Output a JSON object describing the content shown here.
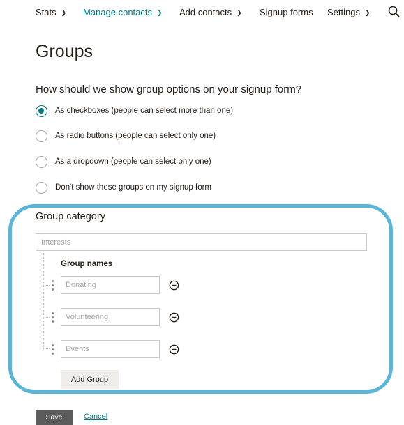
{
  "nav": {
    "items": [
      {
        "label": "Stats",
        "dropdown": true
      },
      {
        "label": "Manage contacts",
        "dropdown": true,
        "active": true
      },
      {
        "label": "Add contacts",
        "dropdown": true
      },
      {
        "label": "Signup forms",
        "dropdown": false
      },
      {
        "label": "Settings",
        "dropdown": true
      }
    ],
    "search_icon": "search-icon"
  },
  "page": {
    "title": "Groups",
    "question": "How should we show group options on your signup form?"
  },
  "display_options": [
    {
      "label": "As checkboxes (people can select more than one)",
      "selected": true
    },
    {
      "label": "As radio buttons (people can select only one)",
      "selected": false
    },
    {
      "label": "As a dropdown (people can select only one)",
      "selected": false
    },
    {
      "label": "Don't show these groups on my signup form",
      "selected": false
    }
  ],
  "group_category": {
    "label": "Group category",
    "placeholder": "Interests",
    "value": ""
  },
  "group_names": {
    "label": "Group names",
    "items": [
      {
        "placeholder": "Donating",
        "value": ""
      },
      {
        "placeholder": "Volunteering",
        "value": ""
      },
      {
        "placeholder": "Events",
        "value": ""
      }
    ],
    "add_button_label": "Add Group"
  },
  "actions": {
    "save_label": "Save",
    "cancel_label": "Cancel"
  },
  "colors": {
    "accent": "#007c89",
    "highlight": "#5ab6d8",
    "save_button": "#5c5c5c",
    "add_button": "#efeeea"
  }
}
